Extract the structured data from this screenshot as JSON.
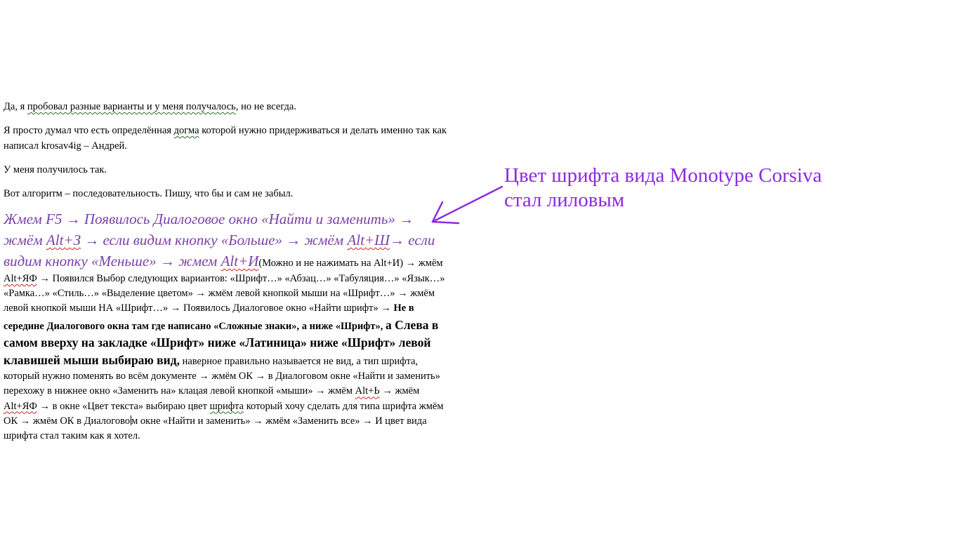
{
  "paragraphs": {
    "p1": {
      "a": "Да, я ",
      "b": "пробовал разные варианты и у меня получалось",
      "c": ", но не всегда."
    },
    "p2": {
      "a": "Я просто думал что есть определённая ",
      "b": "догма",
      "c": " которой нужно придерживаться и делать именно так как написал ",
      "d": "krosav4ig",
      "e": "  – Андрей."
    },
    "p3": "У меня получилось так.",
    "p4": "Вот алгоритм – последовательность. Пишу, что  бы и сам не забыл."
  },
  "algorithm": {
    "c1": "Жмем F5 → Появилось Диалоговое окно «Найти и заменить» → жмём  ",
    "c2": "Alt+З",
    "c3": " → если видим кнопку «Больше» → жмём ",
    "c4": "Alt+Ш",
    "c5": "→ если видим кнопку «Меньше» →  жмем ",
    "c6": "Alt+И",
    "n1": "(Можно и не нажимать на Alt+И) → жмём ",
    "n2": "Alt+ЯФ",
    "n3": " → Появился Выбор следующих  вариантов: «Шрифт…» «Абзац…» «Табуляция…» «Язык…» «Рамка…» «Стиль…» «Выделение цветом»  → жмём левой кнопкой мыши на «Шрифт…» → жмём левой кнопкой мыши НА «Шрифт…» → Появилось Диалоговое окно «Найти шрифт» → ",
    "b1": "Не в середине Диалогового окна там где написано «Сложные знаки», а ниже  «Шрифт», ",
    "b2": "а Слева в самом вверху на закладке «Шрифт» ниже «Латиница» ниже «Шрифт» левой клавишей мыши выбираю вид,",
    "n4": " наверное правильно называется не вид, а тип шрифта, который нужно поменять во всём документе → жмём ОК → в Диалоговом окне «Найти и заменить» перехожу в нижнее окно «Заменить на» клацая левой кнопкой «мыши» → жмём  ",
    "n5": "Alt+Ь",
    "n6": " → жмём ",
    "n7": "Alt+ЯФ",
    "n8": " → в окне «Цвет текста» выбираю цвет ",
    "n9": "шрифта",
    "n10": " который хочу сделать для типа шрифта жмём  ОК → жмём ОК в Диалогово",
    "n11": "м окне «Найти и заменить» → жмём «Заменить все» → И цвет вида шрифта стал  таким как я хотел."
  },
  "annotation": {
    "line1": "Цвет шрифта вида Monotype Corsiva",
    "line2": "стал лиловым"
  },
  "colors": {
    "annotation": "#8a2be2",
    "corsiva_text": "#7b3fa8",
    "arrow": "#8a2be2"
  }
}
